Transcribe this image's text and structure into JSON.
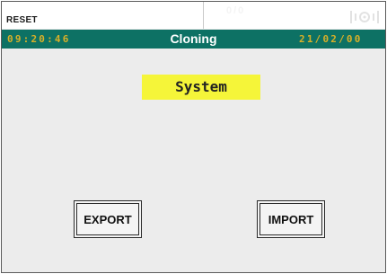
{
  "status_strip": {
    "reset_label": "RESET",
    "counter": "0/0",
    "signal_icon": "radio-signal-icon"
  },
  "title_bar": {
    "time": "09:20:46",
    "title": "Cloning",
    "date": "21/02/00"
  },
  "main": {
    "section_label": "System",
    "buttons": {
      "export_label": "EXPORT",
      "import_label": "IMPORT"
    }
  },
  "colors": {
    "title_bar_bg": "#0d7164",
    "clock_text": "#d8b028",
    "section_highlight": "#f5f539",
    "screen_bg": "#ececec"
  }
}
